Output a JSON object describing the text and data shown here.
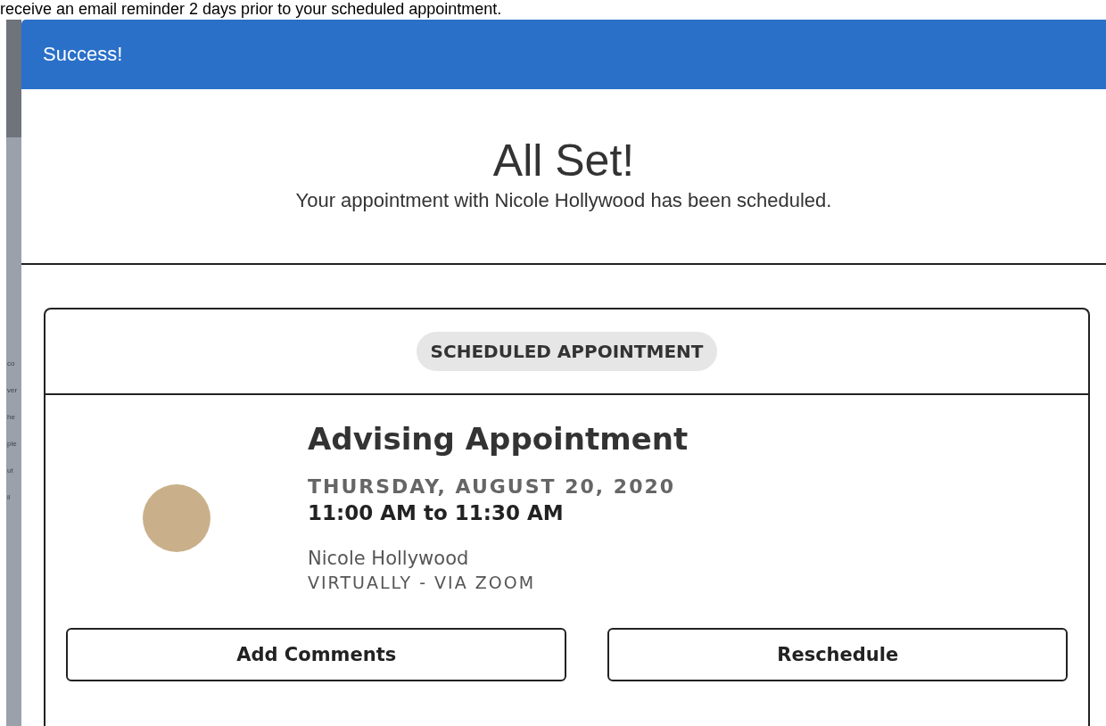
{
  "page_text": "receive an email reminder 2 days prior to your scheduled appointment.",
  "background_fragments": [
    "co",
    "ver",
    "he",
    "ple",
    "ut",
    "il"
  ],
  "modal": {
    "header": "Success!",
    "heading": "All Set!",
    "message": "Your appointment with Nicole Hollywood has been scheduled.",
    "card": {
      "badge": "SCHEDULED APPOINTMENT",
      "title": "Advising Appointment",
      "date": "THURSDAY, AUGUST 20, 2020",
      "time": "11:00 AM to 11:30 AM",
      "advisor": "Nicole Hollywood",
      "location": "VIRTUALLY - VIA ZOOM",
      "buttons": [
        "Add Comments",
        "Reschedule"
      ]
    }
  }
}
